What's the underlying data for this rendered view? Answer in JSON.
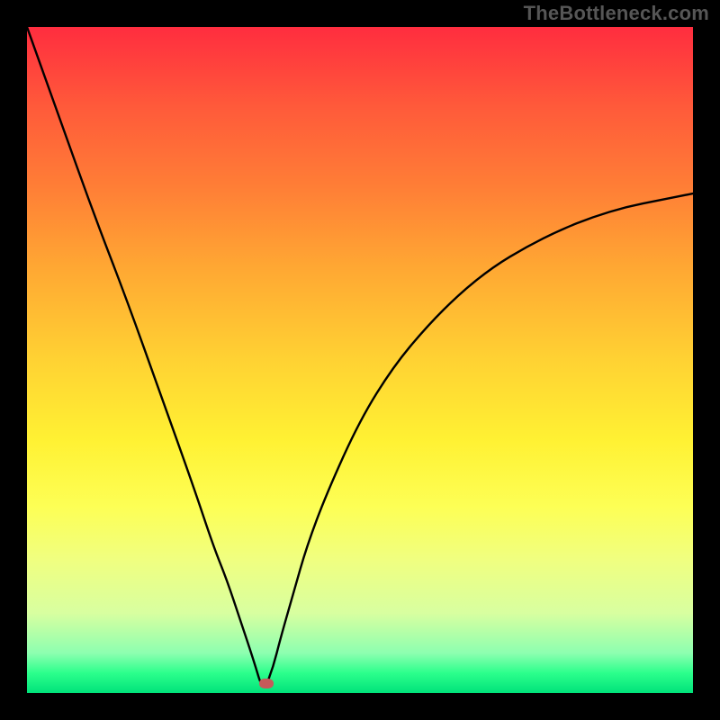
{
  "attribution": "TheBottleneck.com",
  "chart_data": {
    "type": "line",
    "title": "",
    "xlabel": "",
    "ylabel": "",
    "xlim": [
      0,
      100
    ],
    "ylim": [
      0,
      100
    ],
    "series": [
      {
        "name": "bottleneck-curve",
        "x": [
          0,
          5,
          10,
          15,
          20,
          25,
          28,
          30,
          32,
          34,
          35.5,
          37,
          38,
          40,
          42,
          45,
          50,
          55,
          60,
          65,
          70,
          75,
          80,
          85,
          90,
          95,
          100
        ],
        "values": [
          100,
          86,
          72,
          59,
          45,
          31,
          22,
          17,
          11,
          5,
          0,
          4,
          8,
          15,
          22,
          30,
          41,
          49,
          55,
          60,
          64,
          67,
          69.5,
          71.5,
          73,
          74,
          75
        ]
      }
    ],
    "marker": {
      "x": 36,
      "y": 1.5
    },
    "gradient_stops": [
      {
        "offset": 0,
        "color": "#ff2d3f"
      },
      {
        "offset": 50,
        "color": "#ffd233"
      },
      {
        "offset": 100,
        "color": "#00e27a"
      }
    ]
  }
}
